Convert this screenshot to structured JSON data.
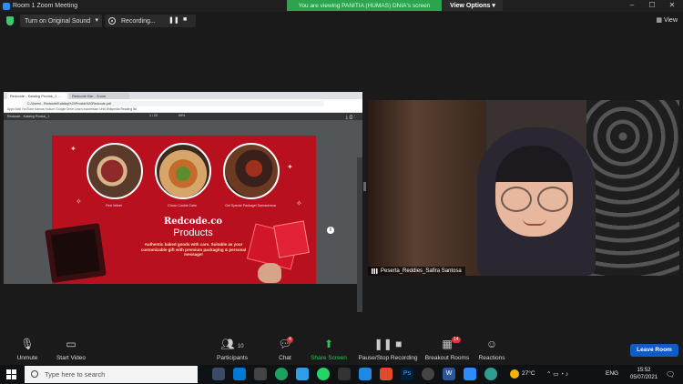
{
  "window": {
    "title": "Room 1  Zoom Meeting"
  },
  "banner": {
    "text": "You are viewing PANITIA (HUMAS) DNIA's screen",
    "view_options": "View Options"
  },
  "window_controls": [
    "–",
    "☐",
    "✕"
  ],
  "top_controls": {
    "sound_button": "Turn on Original Sound",
    "recording_label": "Recording...",
    "view_label": "View"
  },
  "shared_browser": {
    "tabs": [
      "Redcode - Katalog Produk_1 ...",
      "Redcode Bar - Zoom"
    ],
    "address": "C:/Users/...Redcode/Katalog%20Produk%20Redcode.pdf",
    "bookmarks": "Apps   Mail   YouTube   Kamus Hukum   Google Drive   Learn Indonesian   Uniti   Wikipedia   Reading list",
    "pdf_title": "Redcode - Katalog Produk_1",
    "pdf_page": "1 / 20",
    "pdf_zoom": "99%"
  },
  "slide": {
    "captions": [
      "Red Velvet",
      "Choco Cookie Cake",
      "Get Special Package! Samasemua"
    ],
    "brand": "Redcode.co",
    "heading": "Products",
    "description": "Authentic baked goods with care. Suitable as your customizable gift with premium packaging & personal message!"
  },
  "participant": {
    "name": "Peserta_Reddies_Safira Santosa"
  },
  "toolbar": {
    "unmute": "Unmute",
    "start_video": "Start Video",
    "participants": "Participants",
    "participants_count": "10",
    "chat": "Chat",
    "chat_badge": "4",
    "share_screen": "Share Screen",
    "pause_stop_recording": "Pause/Stop Recording",
    "breakout_rooms": "Breakout Rooms",
    "breakout_badge": "14",
    "reactions": "Reactions",
    "leave_room": "Leave Room"
  },
  "taskbar": {
    "search_placeholder": "Type here to search",
    "temperature": "27°C",
    "language": "ENG",
    "time": "15:52",
    "date": "05/07/2021"
  },
  "colors": {
    "banner": "#2da44e",
    "leave": "#0e5cc8",
    "slide_red": "#b8101e"
  }
}
